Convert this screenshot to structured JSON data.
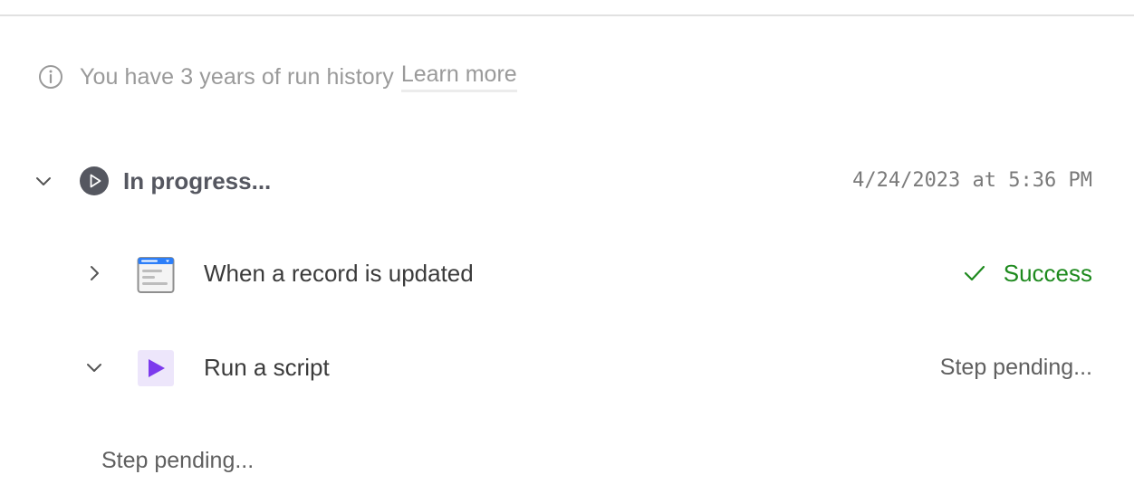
{
  "info": {
    "icon": "info-icon",
    "text": "You have 3 years of run history",
    "link_label": "Learn more"
  },
  "run": {
    "status_icon": "play-circle-icon",
    "title": "In progress...",
    "timestamp": "4/24/2023 at 5:36 PM",
    "expanded": true
  },
  "steps": [
    {
      "icon": "record-trigger-icon",
      "title": "When a record is updated",
      "status": "Success",
      "status_color": "#1e8a1e",
      "expanded": false
    },
    {
      "icon": "run-script-icon",
      "title": "Run a script",
      "status": "Step pending...",
      "expanded": true,
      "body_text": "Step pending..."
    }
  ],
  "colors": {
    "trigger_blue": "#2d7ff9",
    "script_purple": "#7c3aed",
    "script_bg": "#ede6fb",
    "status_dark": "#555760"
  }
}
